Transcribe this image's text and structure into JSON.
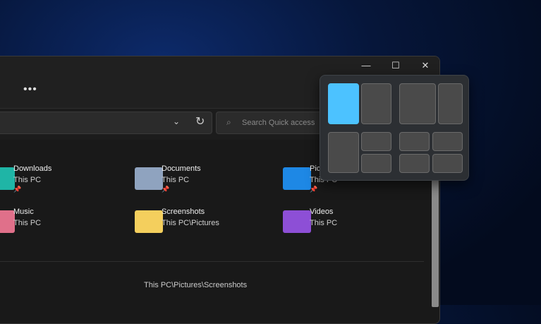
{
  "window": {
    "minimize": "—",
    "maximize": "☐",
    "close": "✕"
  },
  "toolbar": {
    "more_label": "•••"
  },
  "address": {
    "chevron": "⌄",
    "refresh": "↻"
  },
  "search": {
    "placeholder": "Search Quick access",
    "icon": "⌕"
  },
  "items": [
    {
      "name": "Downloads",
      "sub": "This PC",
      "pinned": true,
      "color": "#1fb5a6"
    },
    {
      "name": "Documents",
      "sub": "This PC",
      "pinned": true,
      "color": "#8fa3bf"
    },
    {
      "name": "Pictures",
      "sub": "This PC",
      "pinned": true,
      "color": "#1e88e5"
    },
    {
      "name": "Music",
      "sub": "This PC",
      "pinned": false,
      "color": "#e0708a"
    },
    {
      "name": "Screenshots",
      "sub": "This PC\\Pictures",
      "pinned": false,
      "color": "#f4cf5d"
    },
    {
      "name": "Videos",
      "sub": "This PC",
      "pinned": false,
      "color": "#8d4fd6"
    }
  ],
  "pin_icon": "📌",
  "recent_path": "This PC\\Pictures\\Screenshots",
  "snap_layouts": {
    "selected": "half-left",
    "accent": "#4cc2ff"
  }
}
